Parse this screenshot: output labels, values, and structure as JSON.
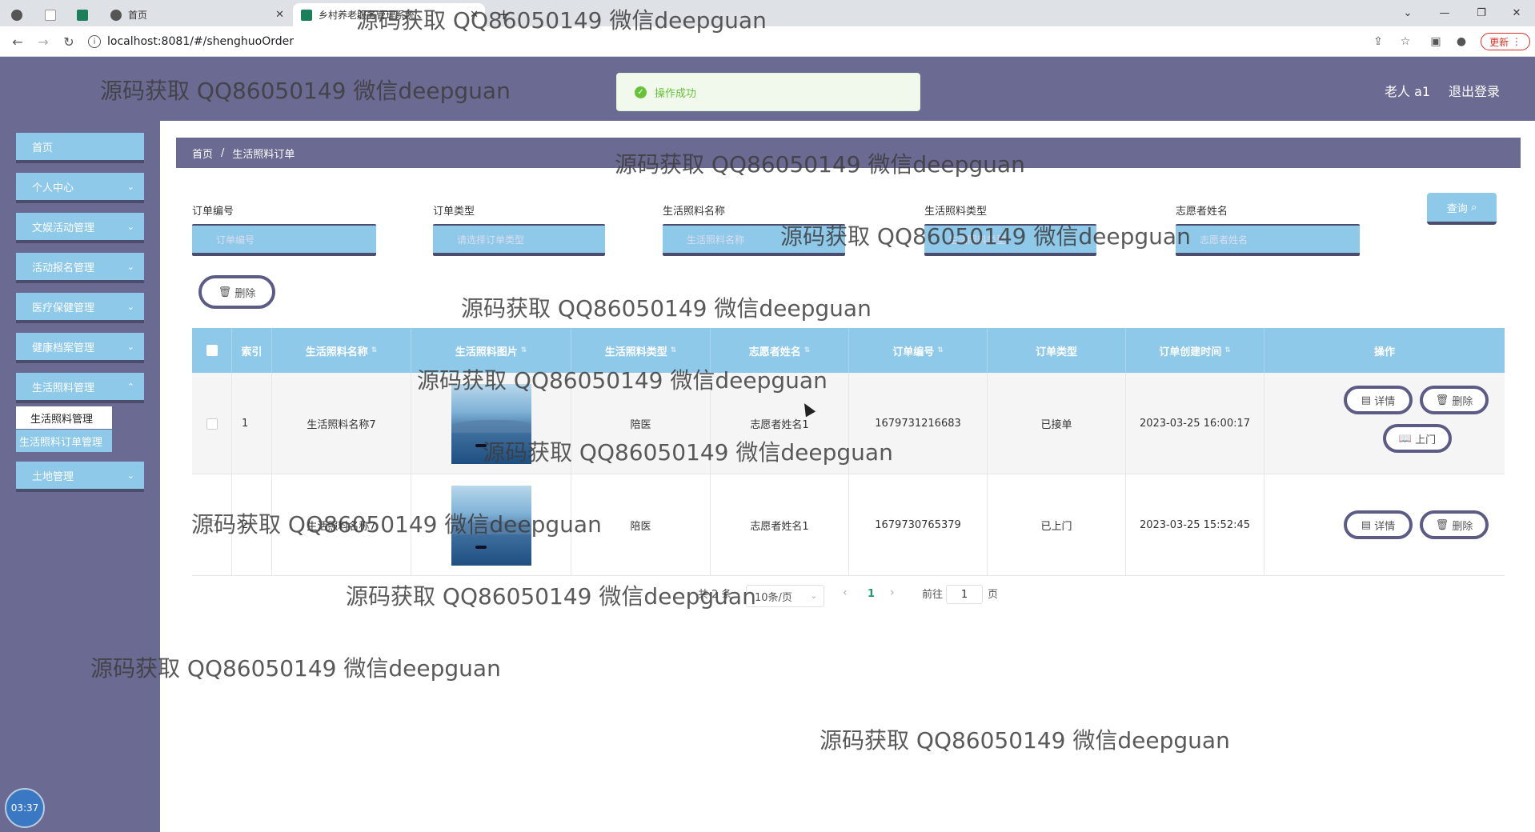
{
  "browser": {
    "tabs": [
      {
        "label": ""
      },
      {
        "label": ""
      },
      {
        "label": ""
      },
      {
        "label": "首页"
      },
      {
        "label": "乡村养老服务管理系统"
      }
    ],
    "url": "localhost:8081/#/shenghuoOrder",
    "update_label": "更新"
  },
  "header": {
    "user": "老人 a1",
    "logout": "退出登录"
  },
  "toast": {
    "message": "操作成功"
  },
  "sidebar": {
    "items": [
      {
        "label": "首页"
      },
      {
        "label": "个人中心"
      },
      {
        "label": "文娱活动管理"
      },
      {
        "label": "活动报名管理"
      },
      {
        "label": "医疗保健管理"
      },
      {
        "label": "健康档案管理"
      },
      {
        "label": "生活照料管理"
      },
      {
        "label": "土地管理"
      }
    ],
    "submenu": [
      {
        "label": "生活照料管理"
      },
      {
        "label": "生活照料订单管理"
      }
    ],
    "clock": "03:37"
  },
  "breadcrumb": {
    "home": "首页",
    "separator": "/",
    "current": "生活照料订单"
  },
  "search": {
    "fields": [
      {
        "label": "订单编号",
        "placeholder": "订单编号"
      },
      {
        "label": "订单类型",
        "placeholder": "请选择订单类型"
      },
      {
        "label": "生活照料名称",
        "placeholder": "生活照料名称"
      },
      {
        "label": "生活照料类型",
        "placeholder": "生活照料类型"
      },
      {
        "label": "志愿者姓名",
        "placeholder": "志愿者姓名"
      }
    ],
    "query_label": "查询",
    "delete_label": "删除"
  },
  "table": {
    "headers": [
      "索引",
      "生活照料名称",
      "生活照料图片",
      "生活照料类型",
      "志愿者姓名",
      "订单编号",
      "订单类型",
      "订单创建时间",
      "操作"
    ],
    "rows": [
      {
        "index": "1",
        "name": "生活照料名称7",
        "type": "陪医",
        "volunteer": "志愿者姓名1",
        "order_no": "1679731216683",
        "order_type": "已接单",
        "created": "2023-03-25 16:00:17",
        "actions": [
          "详情",
          "删除",
          "上门"
        ]
      },
      {
        "index": "2",
        "name": "生活照料名称7",
        "type": "陪医",
        "volunteer": "志愿者姓名1",
        "order_no": "1679730765379",
        "order_type": "已上门",
        "created": "2023-03-25 15:52:45",
        "actions": [
          "详情",
          "删除"
        ]
      }
    ]
  },
  "pagination": {
    "total": "共 2 条",
    "page_size": "10条/页",
    "current_page": "1",
    "goto_label": "前往",
    "goto_value": "1",
    "page_suffix": "页"
  },
  "watermark": "源码获取 QQ86050149 微信deepguan"
}
